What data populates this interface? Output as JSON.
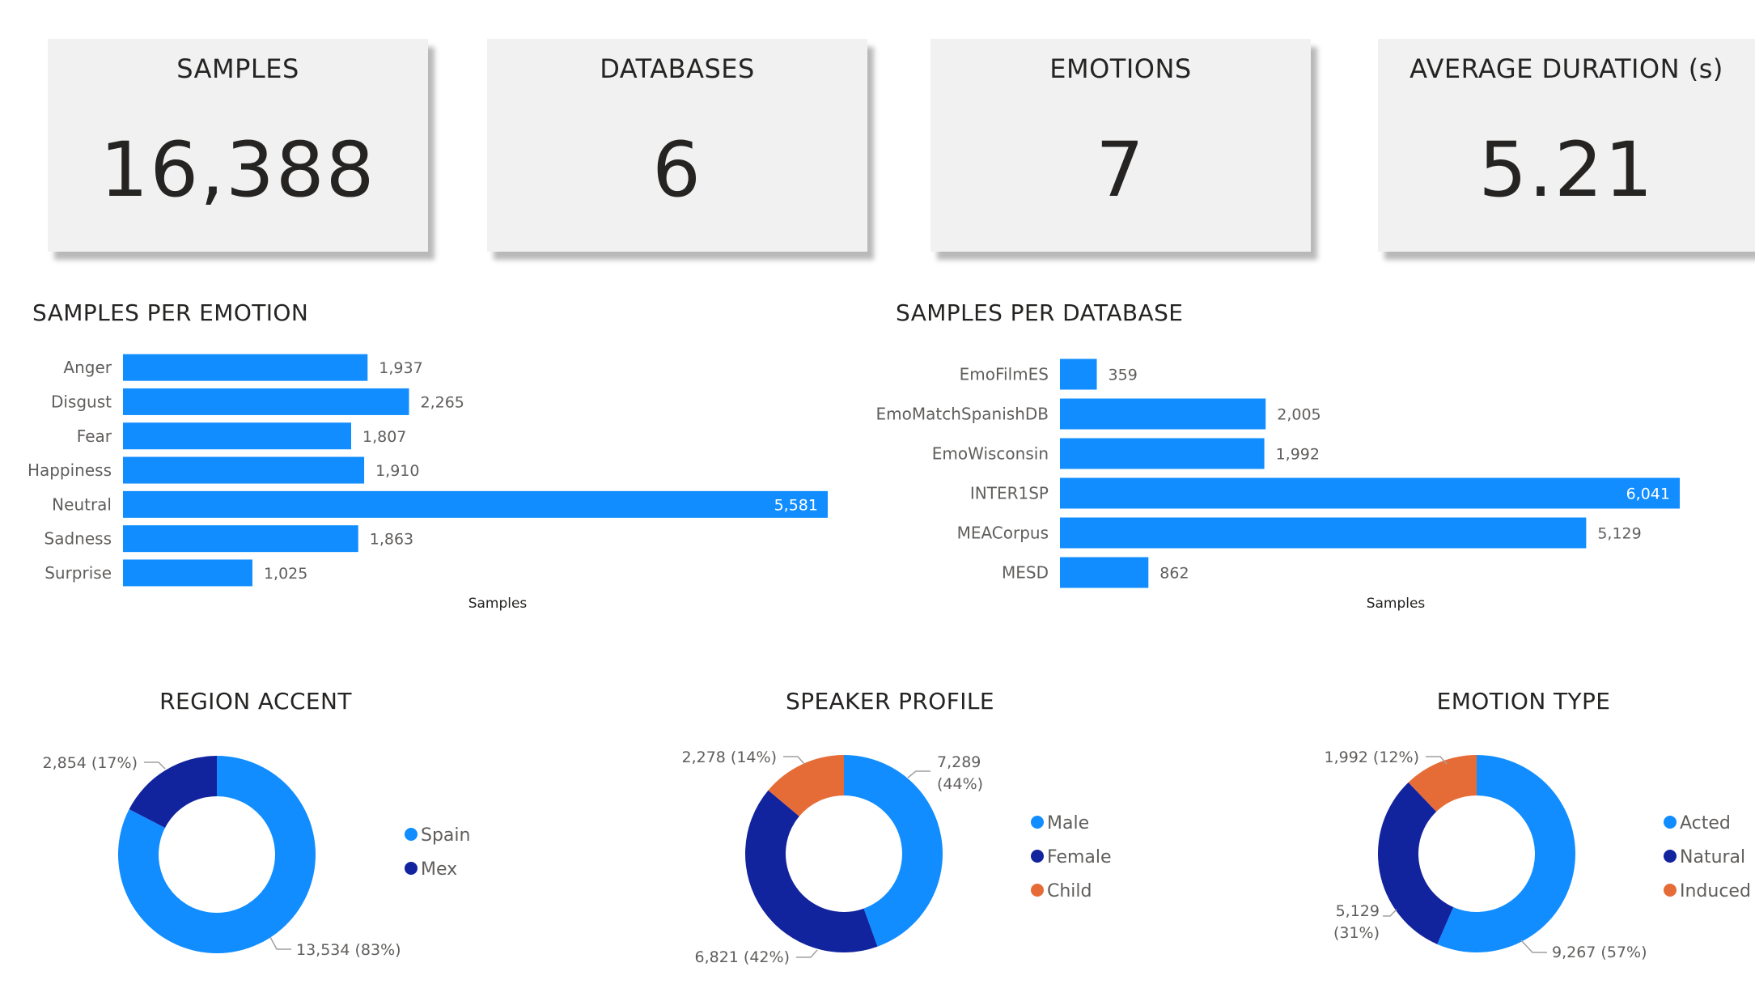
{
  "kpis": [
    {
      "title": "SAMPLES",
      "value": "16,388"
    },
    {
      "title": "DATABASES",
      "value": "6"
    },
    {
      "title": "EMOTIONS",
      "value": "7"
    },
    {
      "title": "AVERAGE DURATION (s)",
      "value": "5.21"
    }
  ],
  "colors": {
    "bar": "#118dff",
    "blue": "#118dff",
    "navy": "#12239e",
    "orange": "#e66c37",
    "text": "#252423",
    "label": "#605e5c"
  },
  "chart_data": [
    {
      "type": "bar",
      "orientation": "horizontal",
      "title": "SAMPLES PER EMOTION",
      "categories": [
        "Anger",
        "Disgust",
        "Fear",
        "Happiness",
        "Neutral",
        "Sadness",
        "Surprise"
      ],
      "values": [
        1937,
        2265,
        1807,
        1910,
        5581,
        1863,
        1025
      ],
      "value_labels": [
        "1,937",
        "2,265",
        "1,807",
        "1,910",
        "5,581",
        "1,863",
        "1,025"
      ],
      "xlabel": "Samples",
      "xlim": [
        0,
        5581
      ]
    },
    {
      "type": "bar",
      "orientation": "horizontal",
      "title": "SAMPLES PER DATABASE",
      "categories": [
        "EmoFilmES",
        "EmoMatchSpanishDB",
        "EmoWisconsin",
        "INTER1SP",
        "MEACorpus",
        "MESD"
      ],
      "values": [
        359,
        2005,
        1992,
        6041,
        5129,
        862
      ],
      "value_labels": [
        "359",
        "2,005",
        "1,992",
        "6,041",
        "5,129",
        "862"
      ],
      "xlabel": "Samples",
      "xlim": [
        0,
        6041
      ]
    },
    {
      "type": "pie",
      "subtype": "donut",
      "title": "REGION ACCENT",
      "categories": [
        "Spain",
        "Mex"
      ],
      "values": [
        13534,
        2854
      ],
      "data_labels": [
        "13,534 (83%)",
        "2,854 (17%)"
      ],
      "colors": [
        "#118dff",
        "#12239e"
      ],
      "legend": "right"
    },
    {
      "type": "pie",
      "subtype": "donut",
      "title": "SPEAKER PROFILE",
      "categories": [
        "Male",
        "Female",
        "Child"
      ],
      "values": [
        7289,
        6821,
        2278
      ],
      "data_labels": [
        [
          "7,289",
          "(44%)"
        ],
        [
          "6,821 (42%)"
        ],
        [
          "2,278 (14%)"
        ]
      ],
      "colors": [
        "#118dff",
        "#12239e",
        "#e66c37"
      ],
      "legend": "right"
    },
    {
      "type": "pie",
      "subtype": "donut",
      "title": "EMOTION TYPE",
      "categories": [
        "Acted",
        "Natural",
        "Induced"
      ],
      "values": [
        9267,
        5129,
        1992
      ],
      "data_labels": [
        [
          "9,267 (57%)"
        ],
        [
          "5,129",
          "(31%)"
        ],
        [
          "1,992 (12%)"
        ]
      ],
      "colors": [
        "#118dff",
        "#12239e",
        "#e66c37"
      ],
      "legend": "right"
    }
  ]
}
